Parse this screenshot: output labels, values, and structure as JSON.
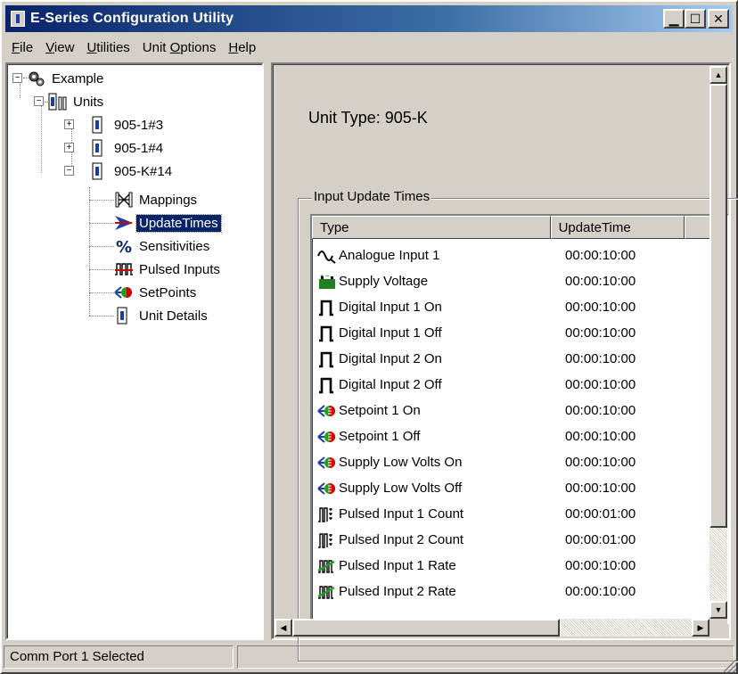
{
  "window": {
    "title": "E-Series Configuration Utility"
  },
  "menu": [
    {
      "label": "File",
      "u": "F",
      "rest": "ile"
    },
    {
      "label": "View",
      "u": "V",
      "rest": "iew"
    },
    {
      "label": "Utilities",
      "u": "U",
      "rest": "tilities"
    },
    {
      "label": "Unit Options",
      "pre": "Unit ",
      "u": "O",
      "rest": "ptions"
    },
    {
      "label": "Help",
      "u": "H",
      "rest": "elp"
    }
  ],
  "tree": {
    "root": "Example",
    "units": "Units",
    "unit1": "905-1#3",
    "unit2": "905-1#4",
    "unit3": "905-K#14",
    "children": {
      "mappings": "Mappings",
      "update_times": "UpdateTimes",
      "sensitivities": "Sensitivities",
      "pulsed_inputs": "Pulsed Inputs",
      "setpoints": "SetPoints",
      "unit_details": "Unit Details"
    }
  },
  "details": {
    "unit_type": "Unit Type: 905-K",
    "group_label": "Input Update Times",
    "columns": {
      "type": "Type",
      "update_time": "UpdateTime"
    },
    "rows": [
      {
        "type": "Analogue Input 1",
        "time": "00:00:10:00",
        "icon": "analogue-icon"
      },
      {
        "type": "Supply Voltage",
        "time": "00:00:10:00",
        "icon": "battery-icon"
      },
      {
        "type": "Digital Input 1 On",
        "time": "00:00:10:00",
        "icon": "pulse-icon"
      },
      {
        "type": "Digital Input 1 Off",
        "time": "00:00:10:00",
        "icon": "pulse-icon"
      },
      {
        "type": "Digital Input 2 On",
        "time": "00:00:10:00",
        "icon": "pulse-icon"
      },
      {
        "type": "Digital Input 2 Off",
        "time": "00:00:10:00",
        "icon": "pulse-icon"
      },
      {
        "type": "Setpoint 1 On",
        "time": "00:00:10:00",
        "icon": "setpoint-icon"
      },
      {
        "type": "Setpoint 1 Off",
        "time": "00:00:10:00",
        "icon": "setpoint-icon"
      },
      {
        "type": "Supply Low Volts On",
        "time": "00:00:10:00",
        "icon": "setpoint-icon"
      },
      {
        "type": "Supply Low Volts Off",
        "time": "00:00:10:00",
        "icon": "setpoint-icon"
      },
      {
        "type": "Pulsed Input 1 Count",
        "time": "00:00:01:00",
        "icon": "pulse-count-icon"
      },
      {
        "type": "Pulsed Input 2 Count",
        "time": "00:00:01:00",
        "icon": "pulse-count-icon"
      },
      {
        "type": "Pulsed Input 1 Rate",
        "time": "00:00:10:00",
        "icon": "pulse-rate-icon"
      },
      {
        "type": "Pulsed Input 2 Rate",
        "time": "00:00:10:00",
        "icon": "pulse-rate-icon"
      }
    ]
  },
  "status": {
    "text": "Comm Port 1 Selected"
  }
}
